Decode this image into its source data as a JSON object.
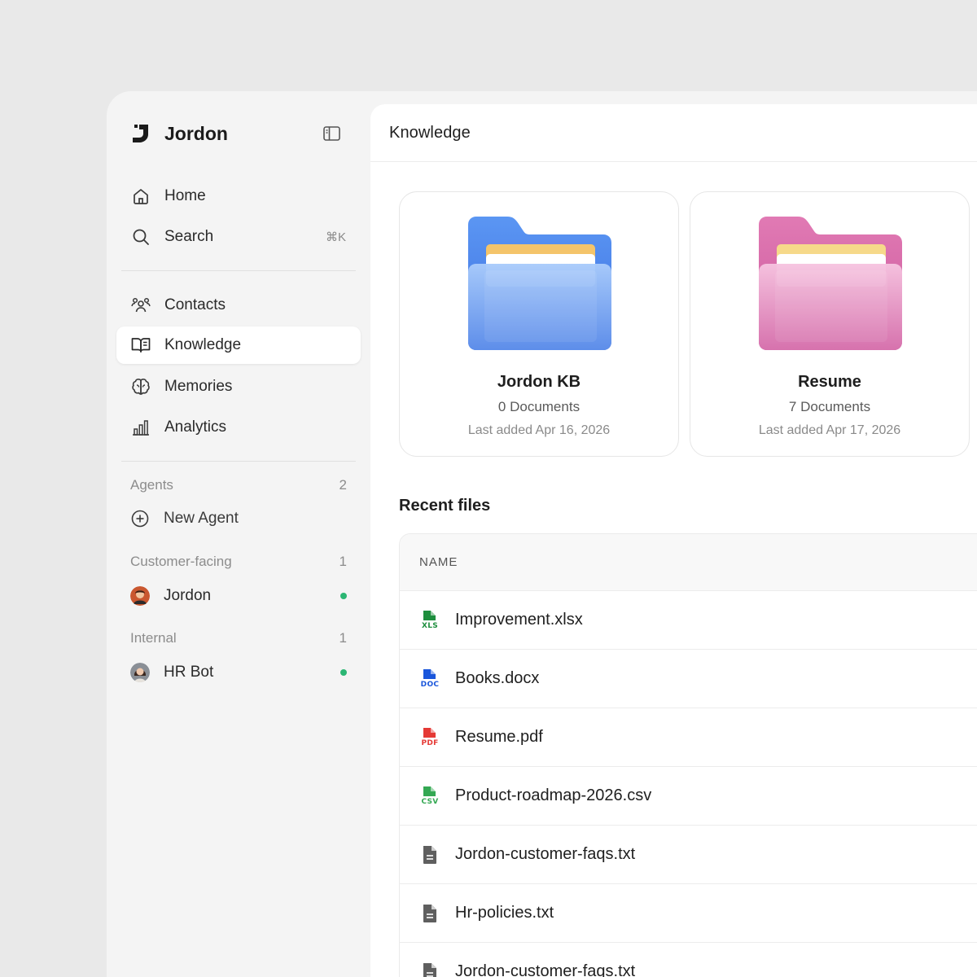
{
  "brand": {
    "name": "Jordon"
  },
  "nav": {
    "home": "Home",
    "search": "Search",
    "search_shortcut": "⌘K",
    "contacts": "Contacts",
    "knowledge": "Knowledge",
    "memories": "Memories",
    "analytics": "Analytics"
  },
  "agents": {
    "label": "Agents",
    "count": "2",
    "new_agent": "New Agent",
    "groups": [
      {
        "label": "Customer-facing",
        "count": "1",
        "agent": {
          "name": "Jordon",
          "status": "online"
        }
      },
      {
        "label": "Internal",
        "count": "1",
        "agent": {
          "name": "HR Bot",
          "status": "online"
        }
      }
    ]
  },
  "main": {
    "title": "Knowledge",
    "folders": [
      {
        "name": "Jordon KB",
        "count": "0 Documents",
        "last_added": "Last added Apr 16, 2026",
        "color": "#5b8ff0"
      },
      {
        "name": "Resume",
        "count": "7 Documents",
        "last_added": "Last added Apr 17, 2026",
        "color": "#e07ab0"
      }
    ],
    "recent": {
      "title": "Recent files",
      "column_name": "NAME",
      "files": [
        {
          "name": "Improvement.xlsx",
          "type": "XLS",
          "color": "#1e8e3e"
        },
        {
          "name": "Books.docx",
          "type": "DOC",
          "color": "#1a56db"
        },
        {
          "name": "Resume.pdf",
          "type": "PDF",
          "color": "#e53935"
        },
        {
          "name": "Product-roadmap-2026.csv",
          "type": "CSV",
          "color": "#34a853"
        },
        {
          "name": "Jordon-customer-faqs.txt",
          "type": "TXT",
          "color": "#5f5f5f"
        },
        {
          "name": "Hr-policies.txt",
          "type": "TXT",
          "color": "#5f5f5f"
        },
        {
          "name": "Jordon-customer-faqs.txt",
          "type": "TXT",
          "color": "#5f5f5f"
        }
      ]
    }
  }
}
